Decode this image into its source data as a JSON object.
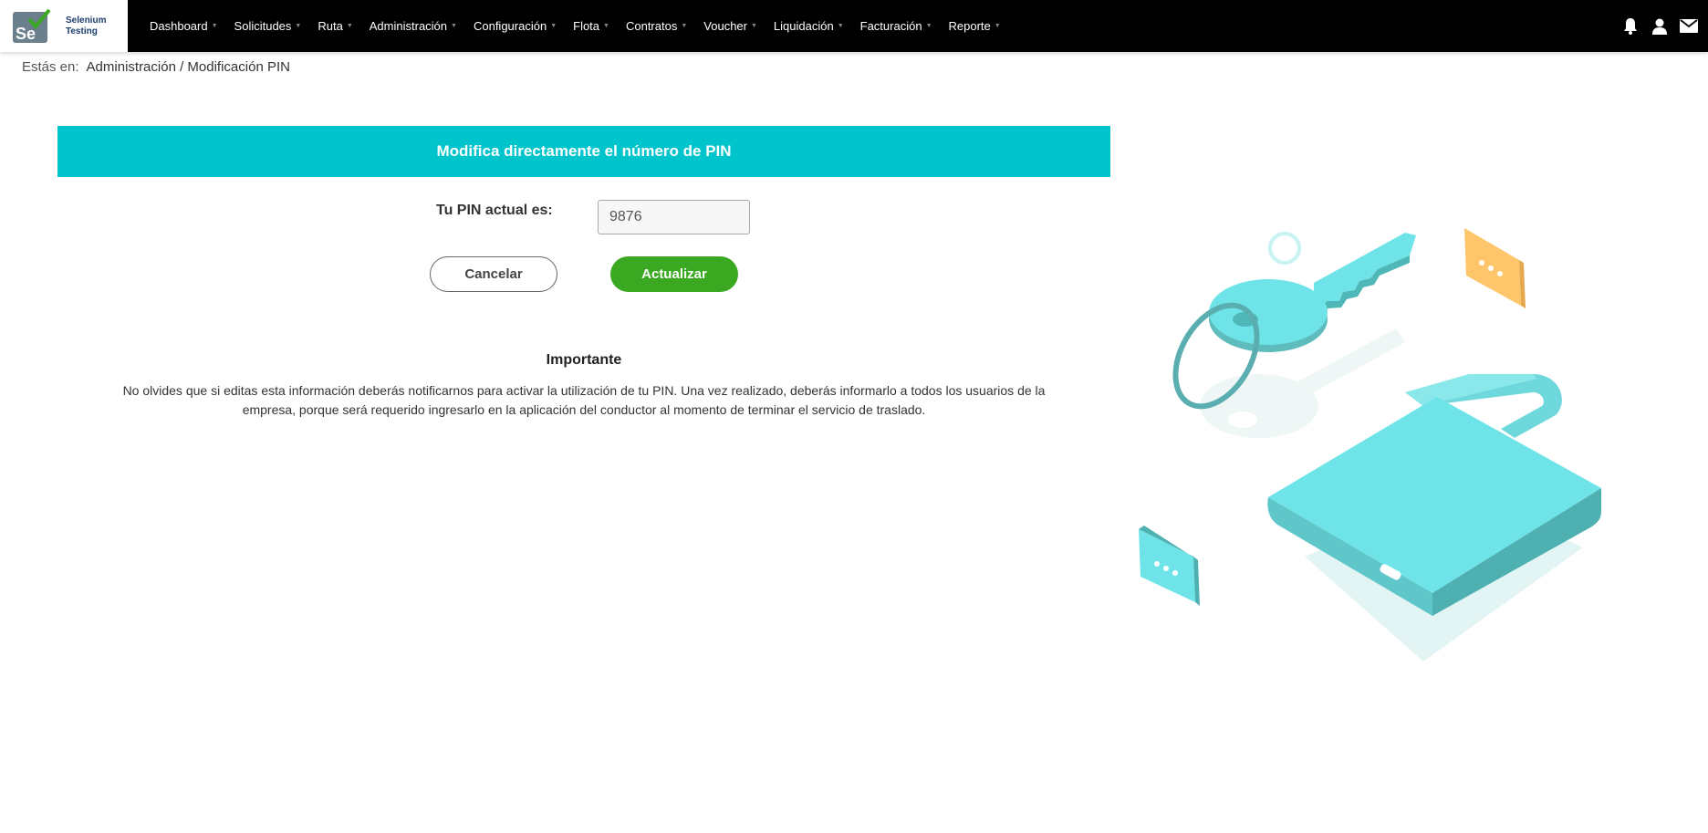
{
  "brand": {
    "logo_text": "Se",
    "name_line1": "Selenium",
    "name_line2": "Testing"
  },
  "nav": {
    "items": [
      {
        "label": "Dashboard"
      },
      {
        "label": "Solicitudes"
      },
      {
        "label": "Ruta"
      },
      {
        "label": "Administración"
      },
      {
        "label": "Configuración"
      },
      {
        "label": "Flota"
      },
      {
        "label": "Contratos"
      },
      {
        "label": "Voucher"
      },
      {
        "label": "Liquidación"
      },
      {
        "label": "Facturación"
      },
      {
        "label": "Reporte"
      }
    ],
    "icons": [
      "bell-icon",
      "user-icon",
      "mail-icon"
    ]
  },
  "breadcrumb": {
    "prefix": "Estás en:",
    "path": "Administración / Modificación PIN"
  },
  "banner": {
    "title": "Modifica directamente el número de PIN"
  },
  "pin": {
    "label": "Tu PIN actual es:",
    "value": "9876"
  },
  "buttons": {
    "cancel": "Cancelar",
    "update": "Actualizar"
  },
  "important": {
    "title": "Importante",
    "text": "No olvides que si editas esta información deberás notificarnos para activar la utilización de tu PIN. Una vez realizado, deberás informarlo a todos los usuarios de la empresa, porque será requerido ingresarlo en la aplicación del conductor al momento de terminar el servicio de traslado."
  },
  "colors": {
    "banner": "#00c4cc",
    "update_button": "#3aa820",
    "navbar": "#000000"
  }
}
